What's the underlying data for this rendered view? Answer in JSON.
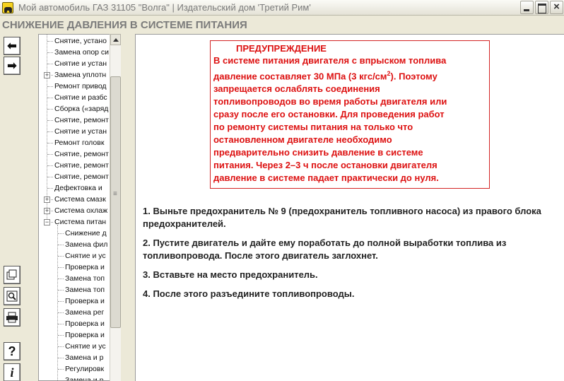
{
  "window": {
    "title": "Мой автомобиль ГАЗ 31105 \"Волга\" | Издательский дом 'Третий Рим'",
    "close_glyph": "×"
  },
  "section": {
    "title": "СНИЖЕНИЕ ДАВЛЕНИЯ В СИСТЕМЕ ПИТАНИЯ"
  },
  "toolbar": {
    "back": "⬅",
    "forward": "➡",
    "icons": [
      "back-arrow-icon",
      "forward-arrow-icon",
      "pages-icon",
      "search-magnifier-icon",
      "printer-icon",
      "help-icon",
      "info-icon"
    ],
    "help_glyph": "?",
    "info_glyph": "i"
  },
  "tree": {
    "items": [
      {
        "label": "Снятие, устано",
        "level": 0
      },
      {
        "label": "Замена опор си",
        "level": 0
      },
      {
        "label": "Снятие и устан",
        "level": 0
      },
      {
        "label": "Замена уплотн",
        "level": 0,
        "expander": "+"
      },
      {
        "label": "Ремонт привод",
        "level": 0
      },
      {
        "label": "Снятие и разбс",
        "level": 0
      },
      {
        "label": "Сборка («заряд",
        "level": 0
      },
      {
        "label": "Снятие, ремонт",
        "level": 0
      },
      {
        "label": "Снятие и устан",
        "level": 0
      },
      {
        "label": "Ремонт головк",
        "level": 0
      },
      {
        "label": "Снятие, ремонт",
        "level": 0
      },
      {
        "label": "Снятие, ремонт",
        "level": 0
      },
      {
        "label": "Снятие, ремонт",
        "level": 0
      },
      {
        "label": "Дефектовка и",
        "level": 0
      },
      {
        "label": "Система смазк",
        "level": 0,
        "expander": "+"
      },
      {
        "label": "Система охлаж",
        "level": 0,
        "expander": "+"
      },
      {
        "label": "Система питан",
        "level": 0,
        "expander": "−"
      },
      {
        "label": "Снижение д",
        "level": 1
      },
      {
        "label": "Замена фил",
        "level": 1
      },
      {
        "label": "Снятие и ус",
        "level": 1
      },
      {
        "label": "Проверка и",
        "level": 1
      },
      {
        "label": "Замена топ",
        "level": 1
      },
      {
        "label": "Замена топ",
        "level": 1
      },
      {
        "label": "Проверка и",
        "level": 1
      },
      {
        "label": "Замена рег",
        "level": 1
      },
      {
        "label": "Проверка и",
        "level": 1
      },
      {
        "label": "Проверка и",
        "level": 1
      },
      {
        "label": "Снятие и ус",
        "level": 1
      },
      {
        "label": "Замена и р",
        "level": 1
      },
      {
        "label": "Регулировк",
        "level": 1
      },
      {
        "label": "Замена и р",
        "level": 1
      }
    ]
  },
  "warning": {
    "title": "ПРЕДУПРЕЖДЕНИЕ",
    "line1": "В системе питания двигателя с впрыском топлива",
    "line2_pre": "давление составляет 30 МПа (3 кгс/см",
    "line2_sup": "2",
    "line2_post": "). Поэтому",
    "lines": [
      "запрещается ослаблять соединения",
      "топливопроводов во время работы двигателя или",
      "сразу после его остановки. Для проведения работ",
      "по ремонту системы питания на только что",
      "остановленном двигателе необходимо",
      "предварительно снизить давление в системе",
      "питания. Через 2–3 ч после остановки двигателя",
      "давление в системе падает практически до нуля."
    ]
  },
  "steps": [
    "1. Выньте предохранитель № 9 (предохранитель топливного насоса) из правого блока предохранителей.",
    "2. Пустите двигатель и дайте ему поработать до полной выработки топлива из топливопровода. После этого двигатель заглохнет.",
    "3. Вставьте на место предохранитель.",
    "4. После этого разъедините топливопроводы."
  ],
  "colors": {
    "warning": "#dd1111",
    "title_text": "#7a7a7a",
    "background": "#ece9d8"
  }
}
